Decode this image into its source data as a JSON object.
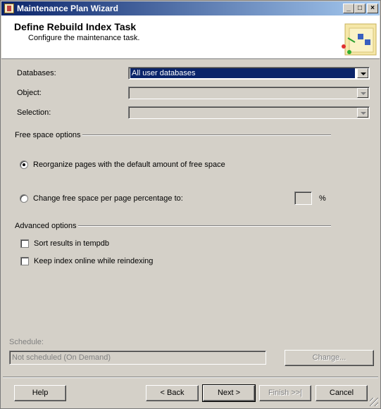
{
  "window": {
    "title": "Maintenance Plan Wizard"
  },
  "header": {
    "title": "Define Rebuild Index Task",
    "subtitle": "Configure the maintenance task."
  },
  "form": {
    "databases_label": "Databases:",
    "databases_value": "All user databases",
    "object_label": "Object:",
    "object_value": "",
    "selection_label": "Selection:",
    "selection_value": ""
  },
  "free_space": {
    "group_label": "Free space options",
    "option_default_label": "Reorganize pages with the default amount of free space",
    "option_default_selected": true,
    "option_percent_label": "Change free space per page percentage to:",
    "option_percent_selected": false,
    "percent_value": "",
    "percent_unit": "%"
  },
  "advanced": {
    "group_label": "Advanced options",
    "sort_tempdb_label": "Sort results in tempdb",
    "sort_tempdb_checked": false,
    "keep_online_label": "Keep index online while reindexing",
    "keep_online_checked": false
  },
  "schedule": {
    "label": "Schedule:",
    "value": "Not scheduled (On Demand)",
    "change_label": "Change..."
  },
  "footer": {
    "help_label": "Help",
    "back_label": "< Back",
    "next_label": "Next >",
    "finish_label": "Finish >>|",
    "cancel_label": "Cancel"
  }
}
